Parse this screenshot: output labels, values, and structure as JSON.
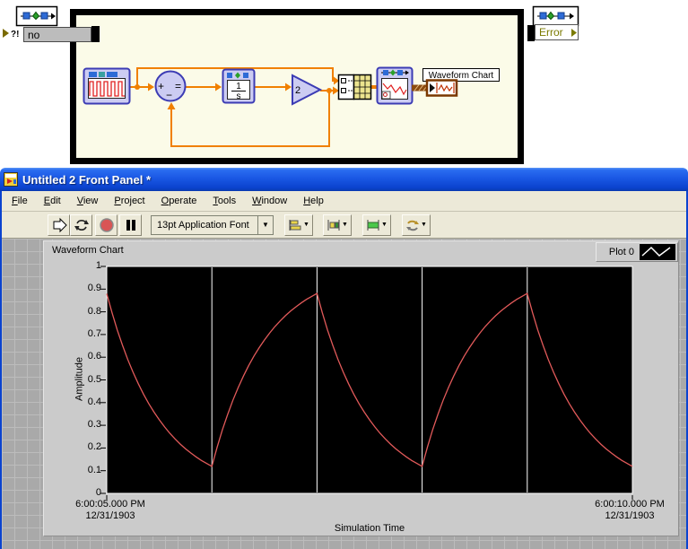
{
  "block_diagram": {
    "left_node": {
      "prefix": "?!",
      "value": "no"
    },
    "right_node": {
      "label": "Error"
    },
    "sum": {
      "plus": "+",
      "minus": "−",
      "equals": "="
    },
    "integrator": {
      "numerator": "1",
      "denominator": "s"
    },
    "gain": {
      "value": "2"
    },
    "chart_terminal": {
      "label": "Waveform Chart"
    }
  },
  "window": {
    "title": "Untitled 2 Front Panel *"
  },
  "menu": {
    "items": [
      {
        "key": "F",
        "rest": "ile"
      },
      {
        "key": "E",
        "rest": "dit"
      },
      {
        "key": "V",
        "rest": "iew"
      },
      {
        "key": "P",
        "rest": "roject"
      },
      {
        "key": "O",
        "rest": "perate"
      },
      {
        "key": "T",
        "rest": "ools"
      },
      {
        "key": "W",
        "rest": "indow"
      },
      {
        "key": "H",
        "rest": "elp"
      }
    ]
  },
  "toolbar": {
    "font_selector": "13pt Application Font"
  },
  "chart": {
    "label": "Waveform Chart",
    "legend_plot_name": "Plot 0",
    "y_label": "Amplitude",
    "x_label": "Simulation Time",
    "x_start_time": "6:00:05.000 PM",
    "x_start_date": "12/31/1903",
    "x_end_time": "6:00:10.000 PM",
    "x_end_date": "12/31/1903"
  },
  "colors": {
    "titlebar_blue": "#1a57e4",
    "wire_orange": "#f08000",
    "node_lavender": "#ccccf2",
    "error_olive": "#7a7a00",
    "panel_gray": "#cbcbcb"
  },
  "chart_data": {
    "type": "line",
    "title": "Waveform Chart",
    "xlabel": "Simulation Time",
    "ylabel": "Amplitude",
    "x_axis_start_label": "6:00:05.000 PM 12/31/1903",
    "x_axis_end_label": "6:00:10.000 PM 12/31/1903",
    "x_range_seconds": [
      0,
      5
    ],
    "ylim": [
      0,
      1
    ],
    "y_ticks": [
      0,
      0.1,
      0.2,
      0.3,
      0.4,
      0.5,
      0.6,
      0.7,
      0.8,
      0.9,
      1
    ],
    "x_gridlines_seconds": [
      1,
      2,
      3,
      4
    ],
    "grid_color": "#ffffff",
    "plot_color": "#e25a5a",
    "plot_area_bg": "#000000",
    "legend": {
      "position": "top-right",
      "entries": [
        "Plot 0"
      ]
    },
    "series": [
      {
        "name": "Plot 0",
        "t_step": 0.05,
        "values": [
          0.88,
          0.796,
          0.72,
          0.652,
          0.59,
          0.534,
          0.483,
          0.437,
          0.395,
          0.358,
          0.324,
          0.293,
          0.265,
          0.24,
          0.217,
          0.196,
          0.178,
          0.161,
          0.145,
          0.132,
          0.119,
          0.204,
          0.28,
          0.348,
          0.41,
          0.466,
          0.517,
          0.563,
          0.605,
          0.642,
          0.676,
          0.707,
          0.735,
          0.76,
          0.783,
          0.804,
          0.822,
          0.839,
          0.855,
          0.868,
          0.881,
          0.796,
          0.72,
          0.652,
          0.59,
          0.534,
          0.483,
          0.437,
          0.395,
          0.358,
          0.324,
          0.293,
          0.265,
          0.24,
          0.217,
          0.196,
          0.178,
          0.161,
          0.145,
          0.132,
          0.119,
          0.204,
          0.28,
          0.348,
          0.41,
          0.466,
          0.517,
          0.563,
          0.605,
          0.642,
          0.676,
          0.707,
          0.735,
          0.76,
          0.783,
          0.804,
          0.822,
          0.839,
          0.855,
          0.868,
          0.881,
          0.796,
          0.72,
          0.652,
          0.59,
          0.534,
          0.483,
          0.437,
          0.395,
          0.358,
          0.324,
          0.293,
          0.265,
          0.24,
          0.217,
          0.196,
          0.178,
          0.161,
          0.145,
          0.132,
          0.119
        ]
      }
    ]
  }
}
